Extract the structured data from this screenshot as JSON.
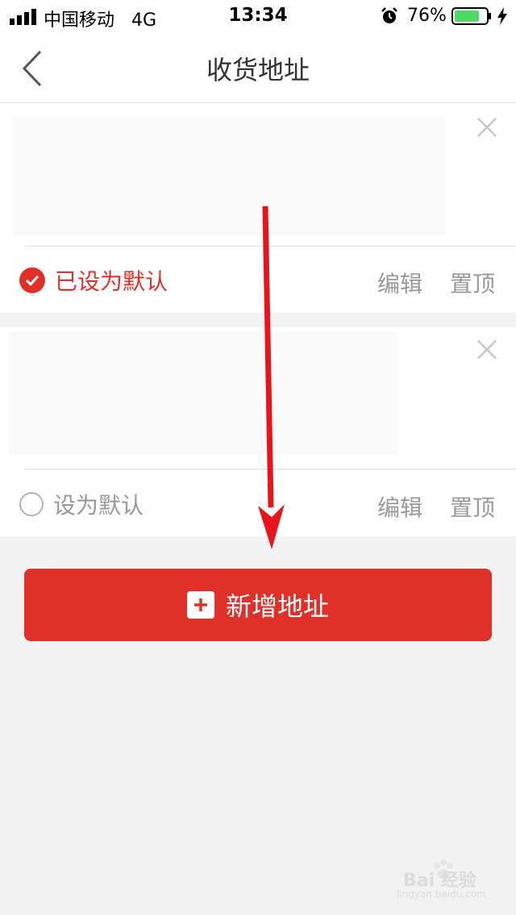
{
  "status_bar": {
    "carrier": "中国移动",
    "network": "4G",
    "time": "13:34",
    "battery": "76%"
  },
  "nav": {
    "title": "收货地址"
  },
  "addresses": [
    {
      "default_label": "已设为默认",
      "is_default": true,
      "edit_label": "编辑",
      "top_label": "置顶"
    },
    {
      "default_label": "设为默认",
      "is_default": false,
      "edit_label": "编辑",
      "top_label": "置顶"
    }
  ],
  "add_button": {
    "label": "新增地址"
  },
  "colors": {
    "accent": "#e0302a",
    "annotation_arrow": "#e8141c"
  },
  "icons": [
    "signal-icon",
    "alarm-icon",
    "battery-icon",
    "charging-icon",
    "back-icon",
    "close-icon",
    "check-icon",
    "plus-icon"
  ],
  "watermark": {
    "text": "Bai 经验",
    "sub": "jingyan.baidu.com"
  }
}
